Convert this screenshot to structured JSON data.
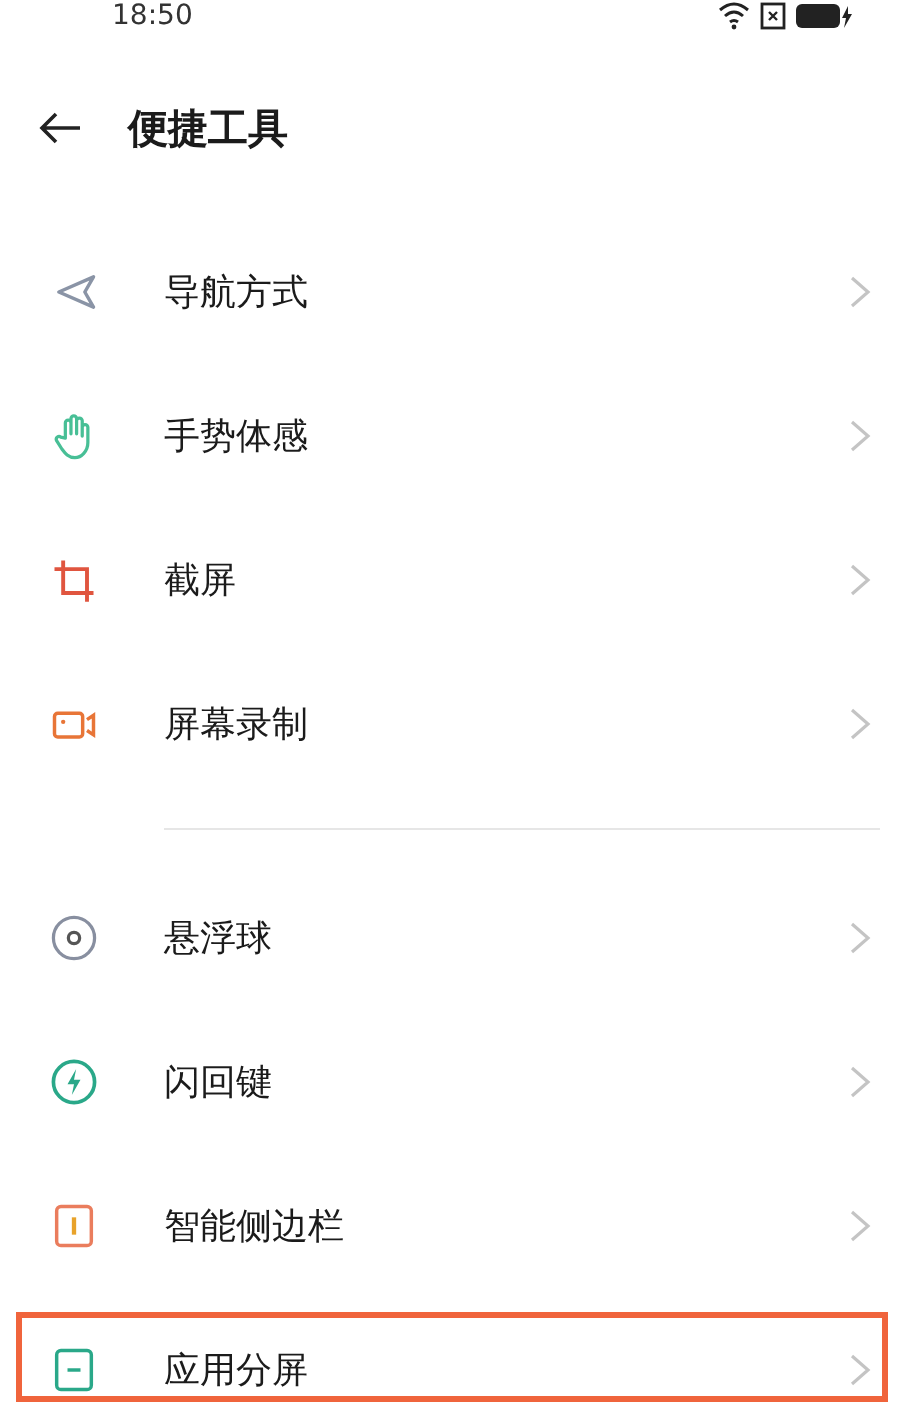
{
  "status_bar": {
    "time": "18:50"
  },
  "header": {
    "title": "便捷工具"
  },
  "groups": [
    {
      "items": [
        {
          "label": "导航方式",
          "kind": "navigation",
          "highlighted": false
        },
        {
          "label": "手势体感",
          "kind": "gesture",
          "highlighted": false
        },
        {
          "label": "截屏",
          "kind": "screenshot",
          "highlighted": false
        },
        {
          "label": "屏幕录制",
          "kind": "record",
          "highlighted": false
        }
      ]
    },
    {
      "items": [
        {
          "label": "悬浮球",
          "kind": "floating-ball",
          "highlighted": false
        },
        {
          "label": "闪回键",
          "kind": "flash",
          "highlighted": false
        },
        {
          "label": "智能侧边栏",
          "kind": "sidebar",
          "highlighted": false
        },
        {
          "label": "应用分屏",
          "kind": "split",
          "highlighted": true
        }
      ]
    }
  ]
}
